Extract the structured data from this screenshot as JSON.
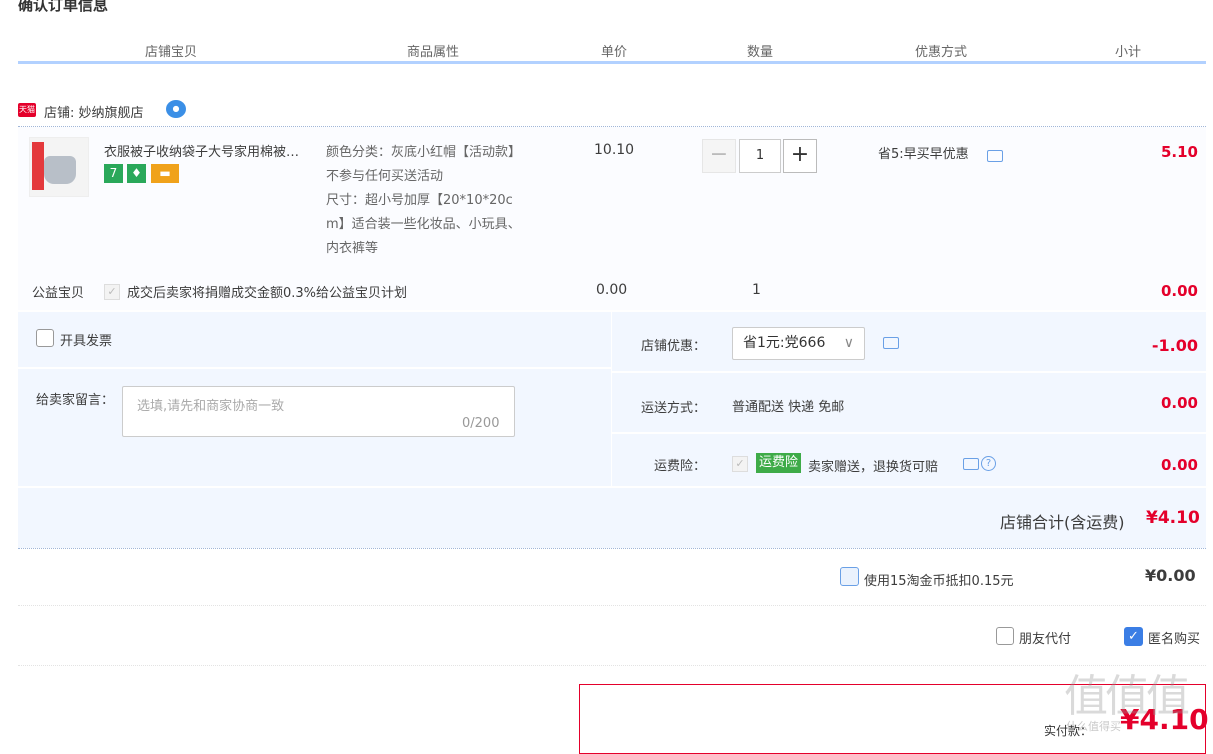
{
  "page_title": "确认订单信息",
  "columns": [
    "店铺宝贝",
    "商品属性",
    "单价",
    "数量",
    "优惠方式",
    "小计"
  ],
  "shop": {
    "badge": "天猫",
    "label": "店铺:",
    "name": "妙纳旗舰店"
  },
  "item": {
    "title": "衣服被子收纳袋子大号家用棉被…",
    "attr_lines": [
      "颜色分类：灰底小红帽【活动款】",
      "不参与任何买送活动",
      "尺寸：超小号加厚【20*10*20c",
      "m】适合装一些化妆品、小玩具、",
      "内衣裤等"
    ],
    "price": "10.10",
    "qty": "1",
    "qty_minus": "−",
    "qty_plus": "+",
    "promo": "省5:早买早优惠",
    "subtotal": "5.10",
    "service_icons": [
      "7",
      "guarantee-icon",
      "card-icon"
    ]
  },
  "charity": {
    "label": "公益宝贝",
    "text": "成交后卖家将捐赠成交金额0.3%给公益宝贝计划",
    "price": "0.00",
    "qty": "1",
    "subtotal": "0.00"
  },
  "invoice": {
    "label": "开具发票"
  },
  "note": {
    "label": "给卖家留言：",
    "placeholder": "选填,请先和商家协商一致",
    "count": "0/200"
  },
  "shop_discount": {
    "label": "店铺优惠：",
    "value": "省1元:党666",
    "amount": "-1.00"
  },
  "shipping": {
    "label": "运送方式：",
    "value": "普通配送 快递 免邮",
    "amount": "0.00"
  },
  "insurance": {
    "label": "运费险：",
    "tag": "运费险",
    "text": "卖家赠送，退换货可赔",
    "amount": "0.00",
    "help": "?"
  },
  "shop_total": {
    "label": "店铺合计(含运费)",
    "value": "¥4.10"
  },
  "coins": {
    "label": "使用15淘金币抵扣0.15元",
    "amount": "¥0.00"
  },
  "friend_pay": {
    "label": "朋友代付"
  },
  "anonymous": {
    "label": "匿名购买",
    "checked": true
  },
  "pay": {
    "label": "实付款：",
    "value": "¥4.10"
  },
  "watermark": {
    "big": "值值值",
    "small": "什么值得买"
  },
  "colors": {
    "accent_red": "#e4002b",
    "header_line": "#b2d1ff",
    "panel_bg": "#f2f7ff",
    "insurance_green": "#3eab48"
  }
}
